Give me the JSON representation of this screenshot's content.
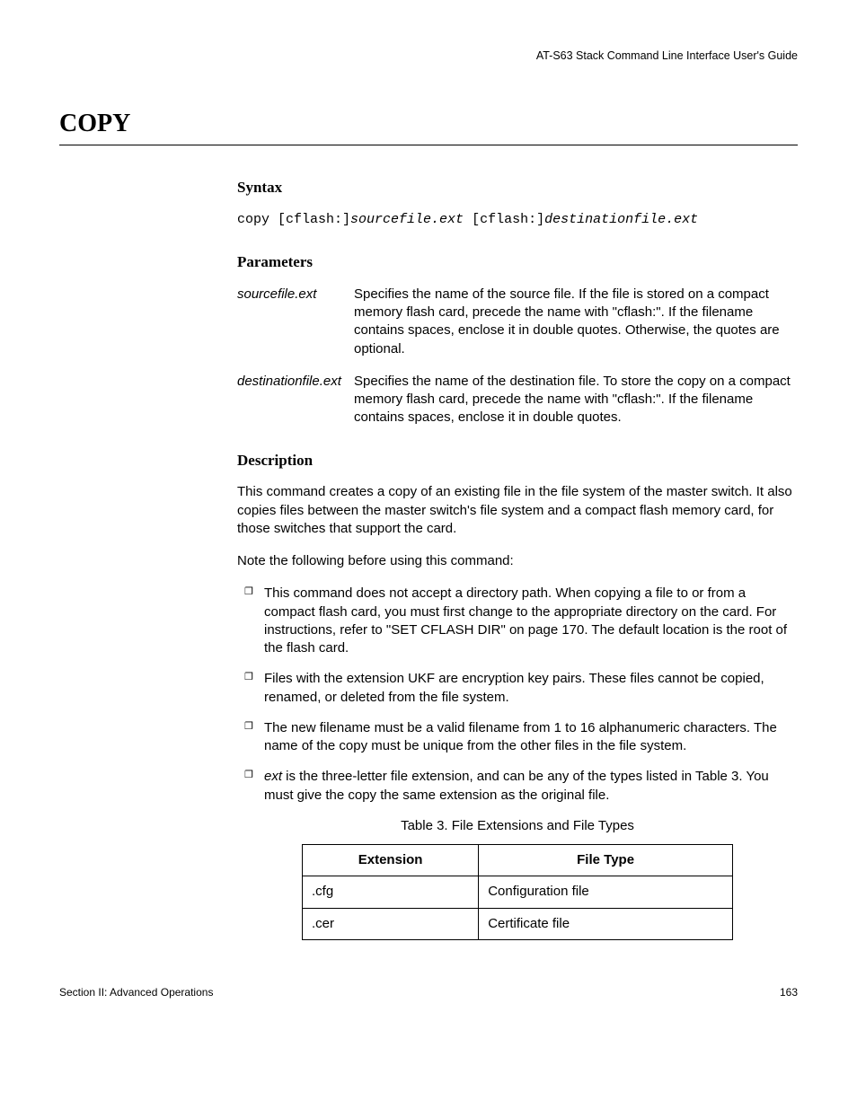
{
  "running_head": "AT-S63 Stack Command Line Interface User's Guide",
  "page_title": "COPY",
  "syntax": {
    "heading": "Syntax",
    "prefix": "copy [cflash:]",
    "src": "sourcefile.ext",
    "mid": " [cflash:]",
    "dst": "destinationfile.ext"
  },
  "parameters": {
    "heading": "Parameters",
    "rows": [
      {
        "name": "sourcefile.ext",
        "desc": "Specifies the name of the source file. If the file is stored on a compact memory flash card, precede the name with \"cflash:\". If the filename contains spaces, enclose it in double quotes. Otherwise, the quotes are optional."
      },
      {
        "name": "destinationfile.ext",
        "desc": "Specifies the name of the destination file. To store the copy on a compact memory flash card, precede the name with \"cflash:\". If the filename contains spaces, enclose it in double quotes."
      }
    ]
  },
  "description": {
    "heading": "Description",
    "para1": "This command creates a copy of an existing file in the file system of the master switch. It also copies files between the master switch's file system and a compact flash memory card, for those switches that support the card.",
    "para2": "Note the following before using this command:",
    "bullets": [
      {
        "text": "This command does not accept a directory path. When copying a file to or from a compact flash card, you must first change to the appropriate directory on the card. For instructions, refer to \"SET CFLASH DIR\" on page 170. The default location is the root of the flash card."
      },
      {
        "text": "Files with the extension UKF are encryption key pairs. These files cannot be copied, renamed, or deleted from the file system."
      },
      {
        "text": "The new filename must be a valid filename from 1 to 16 alphanumeric characters. The name of the copy must be unique from the other files in the file system."
      },
      {
        "lead_italic": "ext",
        "text": " is the three-letter file extension, and can be any of the types listed in Table 3. You must give the copy the same extension as the original file."
      }
    ]
  },
  "table": {
    "caption": "Table 3. File Extensions and File Types",
    "headers": [
      "Extension",
      "File Type"
    ],
    "rows": [
      [
        ".cfg",
        "Configuration file"
      ],
      [
        ".cer",
        "Certificate file"
      ]
    ]
  },
  "footer": {
    "left": "Section II: Advanced Operations",
    "right": "163"
  }
}
